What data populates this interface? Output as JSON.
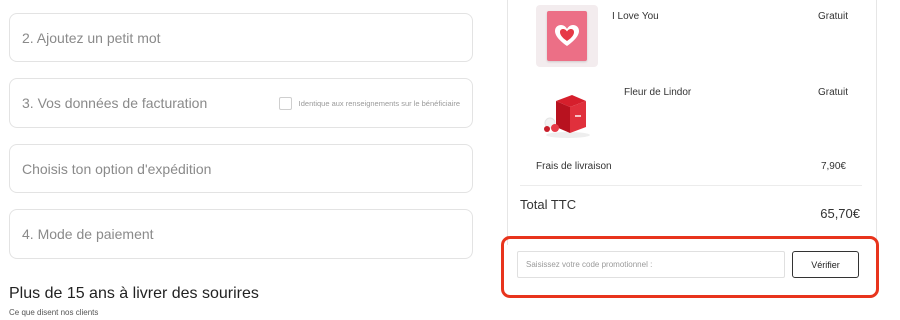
{
  "checkout": {
    "steps": [
      {
        "label": "2. Ajoutez un petit mot"
      },
      {
        "label": "3. Vos données de facturation",
        "checkbox_label": "Identique aux renseignements sur le bénéficiaire",
        "checked": false
      },
      {
        "label": "Choisis ton option d'expédition"
      },
      {
        "label": "4. Mode de paiement"
      }
    ]
  },
  "reviews": {
    "heading": "Plus de 15 ans à livrer des sourires",
    "subheading": "Ce que disent nos clients"
  },
  "summary": {
    "items": [
      {
        "name": "I Love You",
        "price": "Gratuit",
        "icon": "heart-card-icon"
      },
      {
        "name": "Fleur de Lindor",
        "price": "Gratuit",
        "icon": "red-gift-box-icon"
      }
    ],
    "shipping": {
      "label": "Frais de livraison",
      "value": "7,90€"
    },
    "total": {
      "label": "Total TTC",
      "value": "65,70€"
    }
  },
  "promo": {
    "placeholder": "Saisissez votre code promotionnel :",
    "button_label": "Vérifier",
    "highlight_color": "#e8341c"
  }
}
